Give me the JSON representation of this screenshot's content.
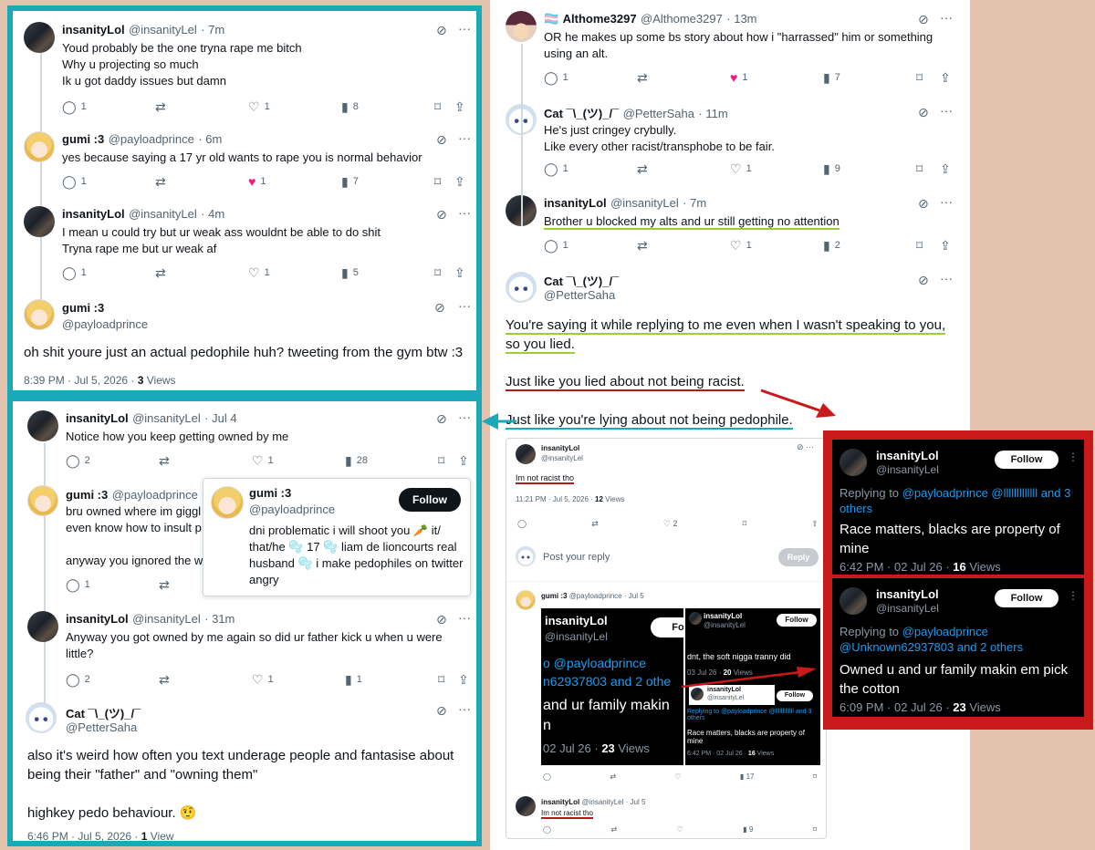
{
  "colors": {
    "teal": "#19a9b8",
    "red": "#c81a1a",
    "pink_bg": "#e3c2ae",
    "like": "#f91880",
    "link": "#1d9bf0"
  },
  "left_top": {
    "tweets": [
      {
        "name": "insanityLol",
        "handle": "@insanityLel",
        "time": "· 7m",
        "text": "Youd probably be the one tryna rape me bitch\nWhy u projecting so much\nIk u got daddy issues but damn",
        "replies": "1",
        "likes": "1",
        "views": "8"
      },
      {
        "name": "gumi :3",
        "handle": "@payloadprince",
        "time": "· 6m",
        "text": "yes because saying a 17 yr old wants to rape you is normal behavior",
        "replies": "1",
        "likes": "1",
        "views": "7"
      },
      {
        "name": "insanityLol",
        "handle": "@insanityLel",
        "time": "· 4m",
        "text": "I mean u could try but ur weak ass wouldnt be able to do shit\nTryna rape me but ur weak af",
        "replies": "1",
        "likes": "1",
        "views": "5"
      }
    ],
    "main": {
      "name": "gumi :3",
      "handle": "@payloadprince",
      "text": "oh shit youre just an actual pedophile huh? tweeting from the gym btw :3",
      "time": "8:39 PM · Jul 5, 2026 · ",
      "views_count": "3",
      "views_label": " Views"
    }
  },
  "left_bottom": {
    "t1": {
      "name": "insanityLol",
      "handle": "@insanityLel",
      "time": "· Jul 4",
      "text": "Notice how you keep getting owned by me",
      "replies": "2",
      "likes": "1",
      "views": "28"
    },
    "t2": {
      "name": "gumi :3",
      "handle": "@payloadprince",
      "text_a": "bru owned where im giggl",
      "text_b": "even know how to insult p",
      "text_c": "anyway you ignored the w",
      "replies": "1"
    },
    "hover": {
      "name": "gumi :3",
      "handle": "@payloadprince",
      "follow": "Follow",
      "bio": "dni problematic i will shoot you 🥕 it/ that/he 🫧 17 🫧 liam de lioncourts real husband 🫧 i make pedophiles on twitter angry"
    },
    "t3": {
      "name": "insanityLol",
      "handle": "@insanityLel",
      "time": "· 31m",
      "text": "Anyway you got owned by me again so did ur father kick u when u were little?",
      "replies": "2",
      "likes": "1",
      "views": "1"
    },
    "t4": {
      "name": "Cat ¯\\_(ツ)_/¯",
      "handle": "@PetterSaha",
      "text": "also it's weird how often you text underage people and fantasise about being their \"father\" and \"owning them\"\n\nhighkey pedo behaviour. 🤨",
      "time": "6:46 PM · Jul 5, 2026 · ",
      "views_count": "1",
      "views_label": " View"
    }
  },
  "right": {
    "t1": {
      "flag": "🏳️‍⚧️",
      "name": "Althome3297",
      "handle": "@Althome3297",
      "time": "· 13m",
      "text": "OR he makes up some bs story about how i \"harrassed\" him or something using an alt.",
      "replies": "1",
      "likes": "1",
      "views": "7"
    },
    "t2": {
      "name": "Cat ¯\\_(ツ)_/¯",
      "handle": "@PetterSaha",
      "time": "· 11m",
      "text": "He's just cringey crybully.\nLike every other racist/transphobe to be fair.",
      "replies": "1",
      "likes": "1",
      "views": "9"
    },
    "t3": {
      "name": "insanityLol",
      "handle": "@insanityLel",
      "time": "· 7m",
      "text": "Brother u blocked my alts and ur still getting no attention",
      "replies": "1",
      "likes": "1",
      "views": "2"
    },
    "main": {
      "name": "Cat ¯\\_(ツ)_/¯",
      "handle": "@PetterSaha",
      "line1": "You're saying it while replying to me even when I wasn't speaking to you,",
      "line2": "so you lied.",
      "line3": "Just like you lied about not being racist.",
      "line4": "Just like you're lying about not being pedophile."
    }
  },
  "embed": {
    "top": {
      "name": "insanityLol",
      "handle": "@insanityLel",
      "text": "Im not racist tho",
      "meta": "11:21 PM · Jul 5, 2026 · ",
      "views_count": "12",
      "views_label": " Views",
      "likes": "2"
    },
    "reply_placeholder": "Post your reply",
    "reply_btn": "Reply",
    "gumi": {
      "name": "gumi :3",
      "handle": "@payloadprince",
      "time": "· Jul 5"
    },
    "inner_left": {
      "name": "insanityLol",
      "handle": "@insanityLel",
      "follow": "Fo",
      "reply": "o @payloadprince\nn62937803 and 2 othe",
      "text": " and ur family makin\nn",
      "meta": "02 Jul 26 · ",
      "views_count": "23",
      "views_label": " Views"
    },
    "inner_right_top": {
      "name": "insanityLol",
      "handle": "@insanityLel",
      "follow": "Follow",
      "text": "dnt, the soft nigga tranny did",
      "meta": "03 Jul 26 · ",
      "views_count": "20",
      "views_label": " Views"
    },
    "inner_right_bottom": {
      "name": "insanityLol",
      "handle": "@insanityLel",
      "follow": "Follow",
      "reply": "Replying to @payloadprince @lllllllllllll and 3 others",
      "text": "Race matters, blacks are property of mine",
      "meta": "6:42 PM · 02 Jul 26 · ",
      "views_count": "16",
      "views_label": " Views"
    },
    "gumi_views": "17",
    "bottom": {
      "name": "insanityLol",
      "handle": "@insanityLel",
      "time": "· Jul 5",
      "text": "Im not racist tho",
      "views": "9"
    }
  },
  "red_box": {
    "c1": {
      "name": "insanityLol",
      "handle": "@insanityLel",
      "follow": "Follow",
      "replying": "Replying to ",
      "mentions": "@payloadprince @lllllllllllll and 3 others",
      "text": "Race matters, blacks are property of mine",
      "meta": "6:42 PM · 02 Jul 26 · ",
      "views_count": "16",
      "views_label": " Views"
    },
    "c2": {
      "name": "insanityLol",
      "handle": "@insanityLel",
      "follow": "Follow",
      "replying": "Replying to ",
      "mentions": "@payloadprince @Unknown62937803 and 2 others",
      "text": "Owned u and ur family makin em pick the cotton",
      "meta": "6:09 PM · 02 Jul 26 · ",
      "views_count": "23",
      "views_label": " Views"
    }
  }
}
